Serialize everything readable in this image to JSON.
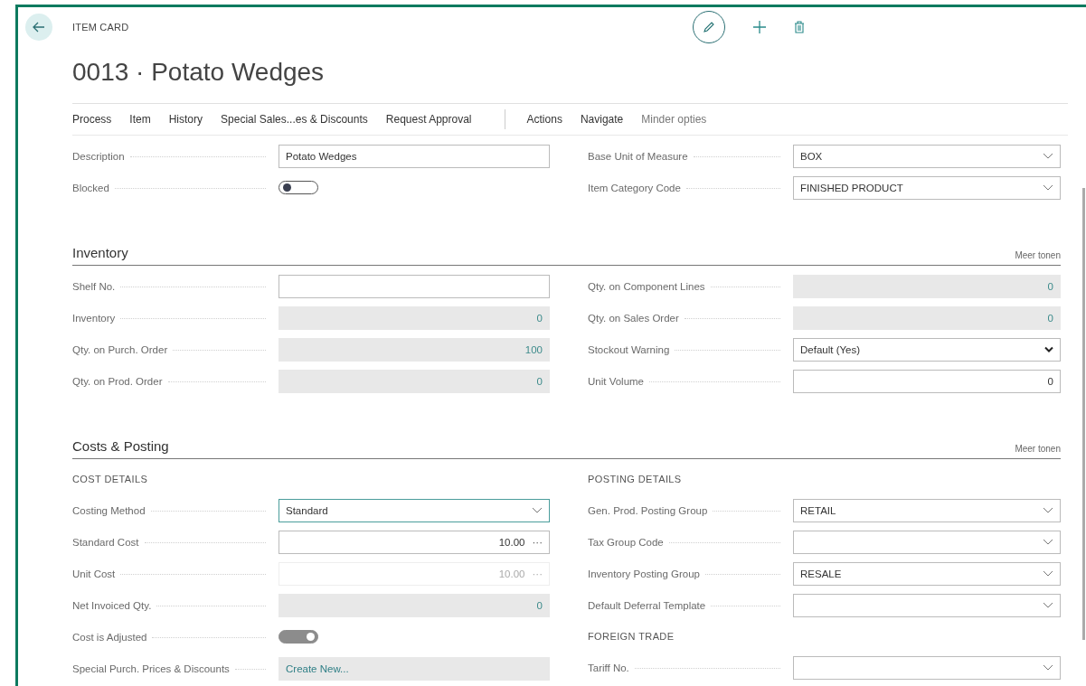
{
  "header": {
    "caption": "ITEM CARD",
    "title": "0013 · Potato Wedges"
  },
  "action_groups": [
    {
      "items": [
        {
          "label": "Process",
          "kind": "menu"
        },
        {
          "label": "Item",
          "kind": "menu"
        },
        {
          "label": "History",
          "kind": "menu"
        },
        {
          "label": "Special Sales...es & Discounts",
          "kind": "menu"
        },
        {
          "label": "Request Approval",
          "kind": "menu"
        }
      ]
    },
    {
      "items": [
        {
          "label": "Actions",
          "kind": "menu"
        },
        {
          "label": "Navigate",
          "kind": "menu"
        },
        {
          "label": "Minder opties",
          "kind": "more"
        }
      ]
    }
  ],
  "blocks": [
    {
      "columns": [
        {
          "groups": [
            {
              "fields": [
                {
                  "label": "Description",
                  "kind": "text",
                  "value": "Potato Wedges"
                },
                {
                  "label": "Blocked",
                  "kind": "toggle",
                  "on": false
                }
              ]
            }
          ]
        },
        {
          "groups": [
            {
              "fields": [
                {
                  "label": "Base Unit of Measure",
                  "kind": "dropdown",
                  "value": "BOX"
                },
                {
                  "label": "Item Category Code",
                  "kind": "dropdown",
                  "value": "FINISHED PRODUCT"
                }
              ]
            }
          ]
        }
      ]
    },
    {
      "title": "Inventory",
      "more": "Meer tonen",
      "columns": [
        {
          "groups": [
            {
              "fields": [
                {
                  "label": "Shelf No.",
                  "kind": "text"
                },
                {
                  "label": "Inventory",
                  "kind": "readonly",
                  "value": "0"
                },
                {
                  "label": "Qty. on Purch. Order",
                  "kind": "readonly",
                  "value": "100"
                },
                {
                  "label": "Qty. on Prod. Order",
                  "kind": "readonly",
                  "value": "0"
                }
              ]
            }
          ]
        },
        {
          "groups": [
            {
              "fields": [
                {
                  "label": "Qty. on Component Lines",
                  "kind": "readonly",
                  "value": "0"
                },
                {
                  "label": "Qty. on Sales Order",
                  "kind": "readonly",
                  "value": "0"
                },
                {
                  "label": "Stockout Warning",
                  "kind": "select",
                  "value": "Default (Yes)"
                },
                {
                  "label": "Unit Volume",
                  "kind": "number",
                  "value": "0"
                }
              ]
            }
          ]
        }
      ]
    },
    {
      "title": "Costs & Posting",
      "more": "Meer tonen",
      "columns": [
        {
          "groups": [
            {
              "heading": "COST DETAILS",
              "fields": [
                {
                  "label": "Costing Method",
                  "kind": "dropdown",
                  "value": "Standard",
                  "focused": true
                },
                {
                  "label": "Standard Cost",
                  "kind": "assist",
                  "value": "10.00",
                  "assist": "···"
                },
                {
                  "label": "Unit Cost",
                  "kind": "assist",
                  "value": "10.00",
                  "assist": "···",
                  "disabled": true
                },
                {
                  "label": "Net Invoiced Qty.",
                  "kind": "readonly",
                  "value": "0"
                },
                {
                  "label": "Cost is Adjusted",
                  "kind": "toggle",
                  "on": true,
                  "disabled": true
                },
                {
                  "label": "Special Purch. Prices & Discounts",
                  "kind": "link",
                  "value": "Create New..."
                }
              ]
            }
          ]
        },
        {
          "groups": [
            {
              "heading": "POSTING DETAILS",
              "fields": [
                {
                  "label": "Gen. Prod. Posting Group",
                  "kind": "dropdown",
                  "value": "RETAIL"
                },
                {
                  "label": "Tax Group Code",
                  "kind": "dropdown"
                },
                {
                  "label": "Inventory Posting Group",
                  "kind": "dropdown",
                  "value": "RESALE"
                },
                {
                  "label": "Default Deferral Template",
                  "kind": "dropdown"
                }
              ]
            },
            {
              "heading": "FOREIGN TRADE",
              "fields": [
                {
                  "label": "Tariff No.",
                  "kind": "dropdown"
                }
              ]
            }
          ]
        }
      ]
    }
  ]
}
